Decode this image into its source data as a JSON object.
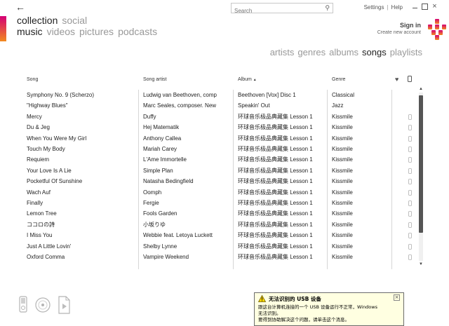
{
  "topbar": {
    "search_placeholder": "Search",
    "settings": "Settings",
    "separator": "|",
    "help": "Help"
  },
  "pivots": {
    "row1": [
      {
        "label": "collection",
        "active": true
      },
      {
        "label": "social",
        "active": false
      }
    ],
    "row2": [
      {
        "label": "music",
        "active": true
      },
      {
        "label": "videos",
        "active": false
      },
      {
        "label": "pictures",
        "active": false
      },
      {
        "label": "podcasts",
        "active": false
      }
    ]
  },
  "account": {
    "sign_in": "Sign in",
    "create": "Create new account"
  },
  "subnav": [
    {
      "label": "artists",
      "active": false
    },
    {
      "label": "genres",
      "active": false
    },
    {
      "label": "albums",
      "active": false
    },
    {
      "label": "songs",
      "active": true
    },
    {
      "label": "playlists",
      "active": false
    }
  ],
  "table": {
    "headers": {
      "song": "Song",
      "artist": "Song artist",
      "album": "Album",
      "sort_indicator": "▲",
      "genre": "Genre"
    },
    "rows": [
      {
        "song": "Symphony No. 9 (Scherzo)",
        "artist": "Ludwig van Beethoven, comp",
        "album": "Beethoven [Vox] Disc 1",
        "genre": "Classical",
        "device": false
      },
      {
        "song": "\"Highway Blues\"",
        "artist": "Marc Seales, composer. New",
        "album": "Speakin' Out",
        "genre": "Jazz",
        "device": false
      },
      {
        "song": "Mercy",
        "artist": "Duffy",
        "album": "环球音乐极品典藏集 Lesson 1",
        "genre": "Kissmile",
        "device": true
      },
      {
        "song": "Du & Jeg",
        "artist": "Hej Matematik",
        "album": "环球音乐极品典藏集 Lesson 1",
        "genre": "Kissmile",
        "device": true
      },
      {
        "song": "When You Were My Girl",
        "artist": "Anthony Callea",
        "album": "环球音乐极品典藏集 Lesson 1",
        "genre": "Kissmile",
        "device": true
      },
      {
        "song": "Touch My Body",
        "artist": "Mariah Carey",
        "album": "环球音乐极品典藏集 Lesson 1",
        "genre": "Kissmile",
        "device": true
      },
      {
        "song": "Requiem",
        "artist": "L'Ame Immortelle",
        "album": "环球音乐极品典藏集 Lesson 1",
        "genre": "Kissmile",
        "device": true
      },
      {
        "song": "Your Love Is A Lie",
        "artist": "Simple Plan",
        "album": "环球音乐极品典藏集 Lesson 1",
        "genre": "Kissmile",
        "device": true
      },
      {
        "song": "Pocketful Of Sunshine",
        "artist": "Natasha Bedingfield",
        "album": "环球音乐极品典藏集 Lesson 1",
        "genre": "Kissmile",
        "device": true
      },
      {
        "song": "Wach Auf",
        "artist": "Oomph",
        "album": "环球音乐极品典藏集 Lesson 1",
        "genre": "Kissmile",
        "device": true
      },
      {
        "song": "Finally",
        "artist": "Fergie",
        "album": "环球音乐极品典藏集 Lesson 1",
        "genre": "Kissmile",
        "device": true
      },
      {
        "song": "Lemon Tree",
        "artist": "Fools Garden",
        "album": "环球音乐极品典藏集 Lesson 1",
        "genre": "Kissmile",
        "device": true
      },
      {
        "song": "ココロの詩",
        "artist": "小坂りゆ",
        "album": "环球音乐极品典藏集 Lesson 1",
        "genre": "Kissmile",
        "device": true
      },
      {
        "song": "I Miss You",
        "artist": "Webbie feat. Letoya Luckett",
        "album": "环球音乐极品典藏集 Lesson 1",
        "genre": "Kissmile",
        "device": true
      },
      {
        "song": "Just A Little Lovin'",
        "artist": "Shelby Lynne",
        "album": "环球音乐极品典藏集 Lesson 1",
        "genre": "Kissmile",
        "device": true
      },
      {
        "song": "Oxford Comma",
        "artist": "Vampire Weekend",
        "album": "环球音乐极品典藏集 Lesson 1",
        "genre": "Kissmile",
        "device": true
      }
    ]
  },
  "balloon": {
    "title": "无法识别的 USB 设备",
    "lines": [
      "跟这台计算机连接的一个 USB 设备运行不正常，Windows",
      "无法识别。",
      "要得到协助解决这个问题，请单击这个消息。"
    ]
  },
  "colors": {
    "accent_top": "#d40075",
    "accent_bottom": "#f28a1f",
    "active_text": "#222222",
    "inactive_text": "#999999",
    "balloon_bg": "#ffffe1"
  }
}
